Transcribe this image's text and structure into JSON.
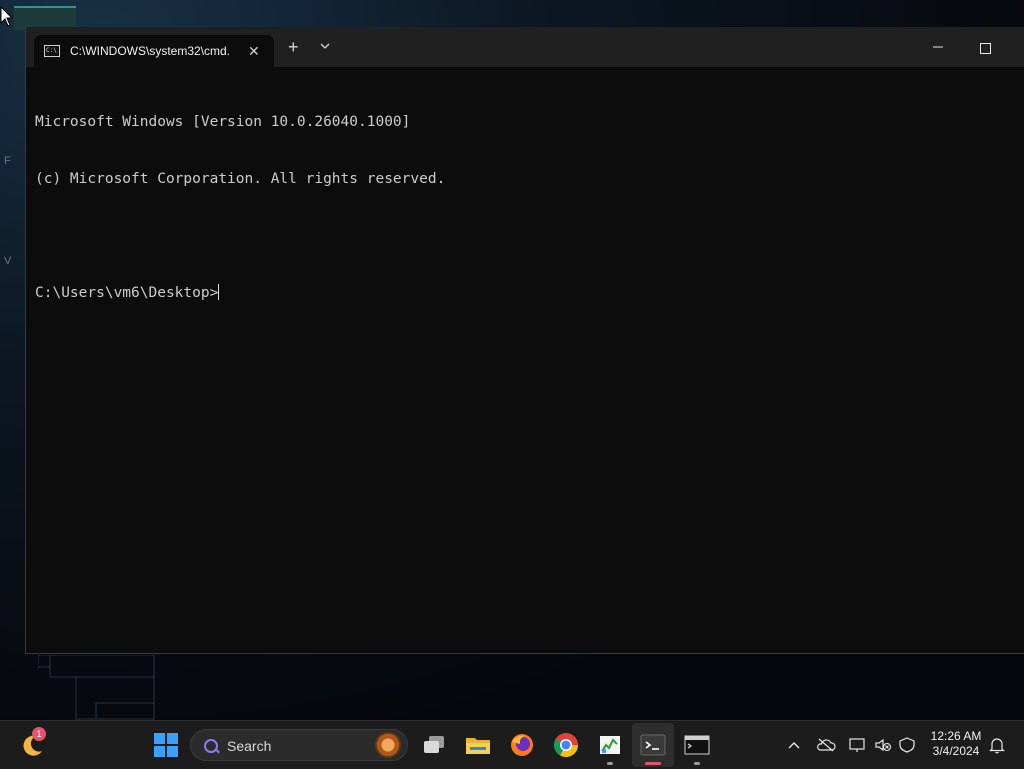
{
  "window": {
    "tab_title": "C:\\WINDOWS\\system32\\cmd.",
    "tab_icon_text": "C:\\",
    "close_glyph": "✕",
    "new_tab_glyph": "+",
    "dropdown_glyph": "⌵",
    "minimize_glyph": "—"
  },
  "console": {
    "lines": [
      "Microsoft Windows [Version 10.0.26040.1000]",
      "(c) Microsoft Corporation. All rights reserved.",
      "",
      "C:\\Users\\vm6\\Desktop>"
    ]
  },
  "taskbar": {
    "widget_badge": "1",
    "search_label": "Search",
    "pinned_icons": [
      "start-icon",
      "task-view-icon",
      "file-explorer-icon",
      "firefox-icon",
      "chrome-icon",
      "task-manager-icon",
      "terminal-icon",
      "cmd-icon"
    ],
    "tray": {
      "time": "12:26 AM",
      "date": "3/4/2024"
    }
  },
  "colors": {
    "accent_search": "#8d7bf5",
    "windows_blue": "#3aa0ff"
  }
}
